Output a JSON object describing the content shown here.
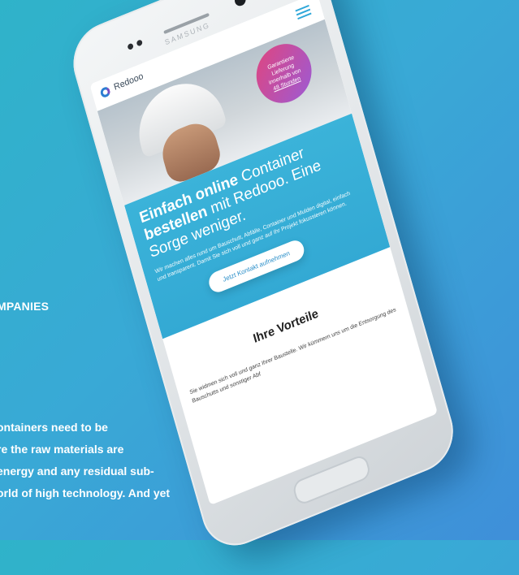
{
  "article": {
    "heading": "MPANIES",
    "paragraph_lines": [
      "ontainers need to be",
      "re the raw materials are",
      "energy and any residual sub-",
      "orld of high technology. And yet"
    ]
  },
  "phone": {
    "brand": "SAMSUNG"
  },
  "site": {
    "logo": "Redooo",
    "badge_lines": [
      "Garantierte",
      "Lieferung",
      "innerhalb von",
      "48 Stunden"
    ],
    "hero_title_bold1": "Einfach online",
    "hero_title_light1": " Container",
    "hero_title_bold2": "bestellen",
    "hero_title_light2": " mit Redooo. Eine",
    "hero_title_line3": "Sorge weniger.",
    "hero_body": "Wir machen alles rund um Bauschutt, Abfälle, Container und Mulden digital, einfach und transparent. Damit Sie sich voll und ganz auf Ihr Projekt fokussieren können.",
    "cta_label": "Jetzt Kontakt aufnehmen",
    "section_title": "Ihre Vorteile",
    "section_text": "Sie widmen sich voll und ganz Ihrer Baustelle. Wir kümmern uns um die Entsorgung des Bauschutts und sonstiger Abf"
  },
  "colors": {
    "background": "#39a9d6",
    "hero": "#3bb3d9",
    "badge_start": "#e0457e",
    "badge_end": "#9b5bd6"
  }
}
